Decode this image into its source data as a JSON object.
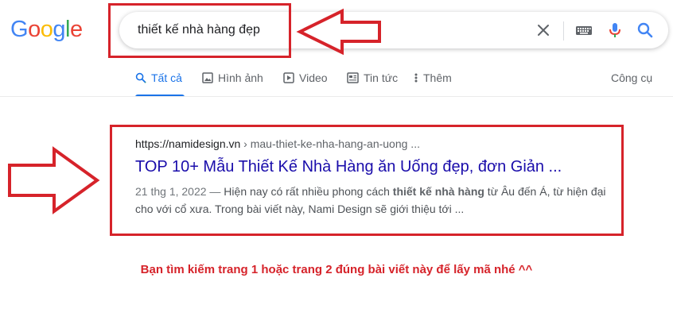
{
  "logo": {
    "letters": [
      "G",
      "o",
      "o",
      "g",
      "l",
      "e"
    ],
    "colors": [
      "#4285f4",
      "#ea4335",
      "#fbbc05",
      "#4285f4",
      "#34a853",
      "#ea4335"
    ]
  },
  "search": {
    "query": "thiết kế nhà hàng đẹp",
    "icons": [
      "clear-icon",
      "keyboard-icon",
      "microphone-icon",
      "search-icon"
    ]
  },
  "tabs": [
    {
      "label": "Tất cả",
      "icon": "search-icon",
      "active": true
    },
    {
      "label": "Hình ảnh",
      "icon": "image-icon",
      "active": false
    },
    {
      "label": "Video",
      "icon": "video-icon",
      "active": false
    },
    {
      "label": "Tin tức",
      "icon": "news-icon",
      "active": false
    },
    {
      "label": "Thêm",
      "icon": "more-icon",
      "active": false
    }
  ],
  "tools_label": "Công cụ",
  "result": {
    "url": "https://namidesign.vn",
    "path": " › mau-thiet-ke-nha-hang-an-uong ...",
    "title": "TOP 10+ Mẫu Thiết Kế Nhà Hàng ăn Uống đẹp, đơn Giản ...",
    "date": "21 thg 1, 2022 —",
    "snippet_before": " Hiện nay có rất nhiều phong cách ",
    "snippet_bold": "thiết kế nhà hàng",
    "snippet_after": " từ Âu đến Á, từ hiện đại cho với cổ xưa. Trong bài viết này, Nami Design sẽ giới thiệu tới ..."
  },
  "instruction": "Bạn tìm kiếm trang 1 hoặc trang 2 đúng bài viết này để lấy mã nhé ^^",
  "colors": {
    "annotation_red": "#d6232a",
    "link_blue": "#1a0dab",
    "active_tab_blue": "#1a73e8"
  }
}
